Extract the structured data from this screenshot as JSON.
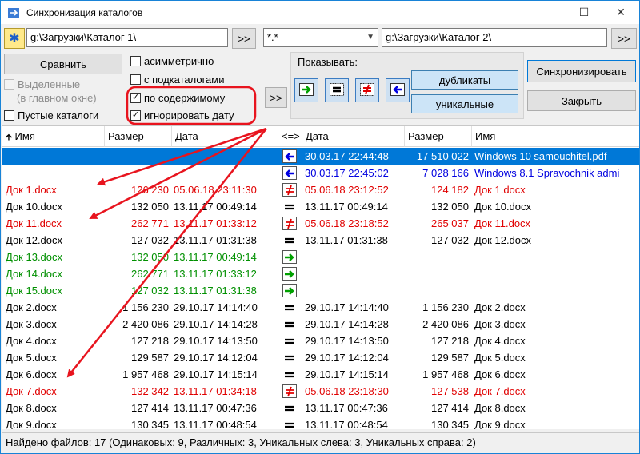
{
  "window": {
    "title": "Синхронизация каталогов"
  },
  "toolbar": {
    "left_path": "g:\\Загрузки\\Каталог 1\\",
    "mask": "*.*",
    "right_path": "g:\\Загрузки\\Каталог 2\\",
    "browse_label": ">>",
    "more_label": ">>"
  },
  "buttons": {
    "compare": "Сравнить",
    "sync": "Синхронизировать",
    "close": "Закрыть",
    "duplicates": "дубликаты",
    "unique": "уникальные"
  },
  "options": {
    "selected_label": "Выделенные",
    "selected_label2": "(в главном окне)",
    "empty_dirs": "Пустые каталоги",
    "asymmetric": "асимметрично",
    "subdirs": "с подкаталогами",
    "by_content": "по содержимому",
    "ignore_date": "игнорировать дату",
    "check": "☑",
    "uncheck": "☐"
  },
  "show": {
    "label": "Показывать:"
  },
  "columns": {
    "name": "Имя",
    "size": "Размер",
    "date": "Дата",
    "cmp": "<=>",
    "date_r": "Дата",
    "size_r": "Размер",
    "name_r": "Имя"
  },
  "colors": {
    "red": "#e00000",
    "green": "#009000",
    "blue": "#0000e0",
    "black": "#000000",
    "selection": "#0078d7",
    "annotation": "#e8141e"
  },
  "rows": [
    {
      "lname": "",
      "lsize": "",
      "ldate": "",
      "mark": "left-arrow-icon",
      "rdate": "30.03.17 22:44:48",
      "rsize": "17 510 022",
      "rname": "Windows 10 samouchitel.pdf",
      "color": "#ffffff"
    },
    {
      "lname": "",
      "lsize": "",
      "ldate": "",
      "mark": "left-arrow-icon",
      "rdate": "30.03.17 22:45:02",
      "rsize": "7 028 166",
      "rname": "Windows 8.1 Spravochnik admi",
      "color": "#0000e0"
    },
    {
      "lname": "Док 1.docx",
      "lsize": "126 230",
      "ldate": "05.06.18 23:11:30",
      "mark": "not-equal-icon",
      "rdate": "05.06.18 23:12:52",
      "rsize": "124 182",
      "rname": "Док 1.docx",
      "color": "#e00000"
    },
    {
      "lname": "Док 10.docx",
      "lsize": "132 050",
      "ldate": "13.11.17 00:49:14",
      "mark": "equal-icon",
      "rdate": "13.11.17 00:49:14",
      "rsize": "132 050",
      "rname": "Док 10.docx",
      "color": "#000000"
    },
    {
      "lname": "Док 11.docx",
      "lsize": "262 771",
      "ldate": "13.11.17 01:33:12",
      "mark": "not-equal-icon",
      "rdate": "05.06.18 23:18:52",
      "rsize": "265 037",
      "rname": "Док 11.docx",
      "color": "#e00000"
    },
    {
      "lname": "Док 12.docx",
      "lsize": "127 032",
      "ldate": "13.11.17 01:31:38",
      "mark": "equal-icon",
      "rdate": "13.11.17 01:31:38",
      "rsize": "127 032",
      "rname": "Док 12.docx",
      "color": "#000000"
    },
    {
      "lname": "Док 13.docx",
      "lsize": "132 050",
      "ldate": "13.11.17 00:49:14",
      "mark": "right-arrow-icon",
      "rdate": "",
      "rsize": "",
      "rname": "",
      "color": "#009000"
    },
    {
      "lname": "Док 14.docx",
      "lsize": "262 771",
      "ldate": "13.11.17 01:33:12",
      "mark": "right-arrow-icon",
      "rdate": "",
      "rsize": "",
      "rname": "",
      "color": "#009000"
    },
    {
      "lname": "Док 15.docx",
      "lsize": "127 032",
      "ldate": "13.11.17 01:31:38",
      "mark": "right-arrow-icon",
      "rdate": "",
      "rsize": "",
      "rname": "",
      "color": "#009000"
    },
    {
      "lname": "Док 2.docx",
      "lsize": "1 156 230",
      "ldate": "29.10.17 14:14:40",
      "mark": "equal-icon",
      "rdate": "29.10.17 14:14:40",
      "rsize": "1 156 230",
      "rname": "Док 2.docx",
      "color": "#000000"
    },
    {
      "lname": "Док 3.docx",
      "lsize": "2 420 086",
      "ldate": "29.10.17 14:14:28",
      "mark": "equal-icon",
      "rdate": "29.10.17 14:14:28",
      "rsize": "2 420 086",
      "rname": "Док 3.docx",
      "color": "#000000"
    },
    {
      "lname": "Док 4.docx",
      "lsize": "127 218",
      "ldate": "29.10.17 14:13:50",
      "mark": "equal-icon",
      "rdate": "29.10.17 14:13:50",
      "rsize": "127 218",
      "rname": "Док 4.docx",
      "color": "#000000"
    },
    {
      "lname": "Док 5.docx",
      "lsize": "129 587",
      "ldate": "29.10.17 14:12:04",
      "mark": "equal-icon",
      "rdate": "29.10.17 14:12:04",
      "rsize": "129 587",
      "rname": "Док 5.docx",
      "color": "#000000"
    },
    {
      "lname": "Док 6.docx",
      "lsize": "1 957 468",
      "ldate": "29.10.17 14:15:14",
      "mark": "equal-icon",
      "rdate": "29.10.17 14:15:14",
      "rsize": "1 957 468",
      "rname": "Док 6.docx",
      "color": "#000000"
    },
    {
      "lname": "Док 7.docx",
      "lsize": "132 342",
      "ldate": "13.11.17 01:34:18",
      "mark": "not-equal-icon",
      "rdate": "05.06.18 23:18:30",
      "rsize": "127 538",
      "rname": "Док 7.docx",
      "color": "#e00000"
    },
    {
      "lname": "Док 8.docx",
      "lsize": "127 414",
      "ldate": "13.11.17 00:47:36",
      "mark": "equal-icon",
      "rdate": "13.11.17 00:47:36",
      "rsize": "127 414",
      "rname": "Док 8.docx",
      "color": "#000000"
    },
    {
      "lname": "Док 9.docx",
      "lsize": "130 345",
      "ldate": "13.11.17 00:48:54",
      "mark": "equal-icon",
      "rdate": "13.11.17 00:48:54",
      "rsize": "130 345",
      "rname": "Док 9.docx",
      "color": "#000000"
    }
  ],
  "status": "Найдено файлов: 17  (Одинаковых: 9, Различных: 3, Уникальных слева: 3, Уникальных справа: 2)"
}
